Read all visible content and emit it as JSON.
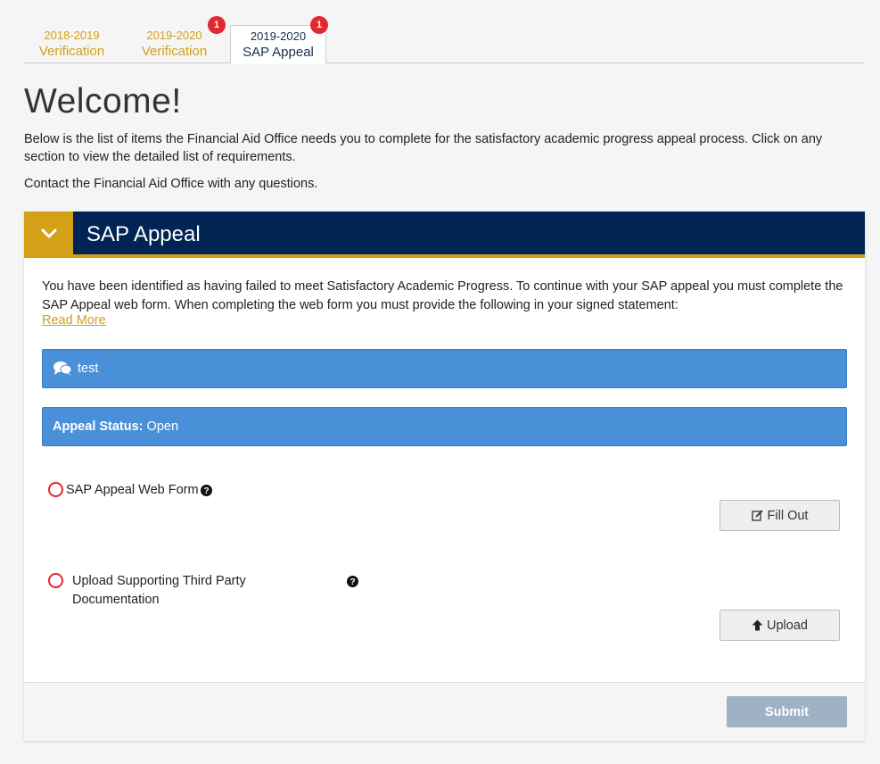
{
  "tabs": [
    {
      "year": "2018-2019",
      "name": "Verification",
      "badge": ""
    },
    {
      "year": "2019-2020",
      "name": "Verification",
      "badge": "1"
    },
    {
      "year": "2019-2020",
      "name": "SAP Appeal",
      "badge": "1"
    }
  ],
  "welcome": "Welcome!",
  "intro": "Below is the list of items the Financial Aid Office needs you to complete for the satisfactory academic progress appeal process. Click on any section to view the detailed list of requirements.",
  "contact": "Contact the Financial Aid Office with any questions.",
  "panel": {
    "title": "SAP Appeal",
    "description": "You have been identified as having failed to meet Satisfactory Academic Progress. To continue with your SAP appeal you must complete the SAP Appeal web form. When completing the web form you must provide the following in your signed statement:",
    "read_more": "Read More",
    "comment": "test",
    "status_label": "Appeal Status:",
    "status_value": "Open",
    "requirements": [
      {
        "label": "SAP Appeal Web Form",
        "button": "Fill Out"
      },
      {
        "label_line1": "Upload Supporting Third Party",
        "label_line2": "Documentation",
        "button": "Upload"
      }
    ],
    "submit": "Submit"
  },
  "colors": {
    "gold": "#d4a017",
    "navy": "#002554",
    "blue": "#4a90d9",
    "red": "#e0282e"
  }
}
